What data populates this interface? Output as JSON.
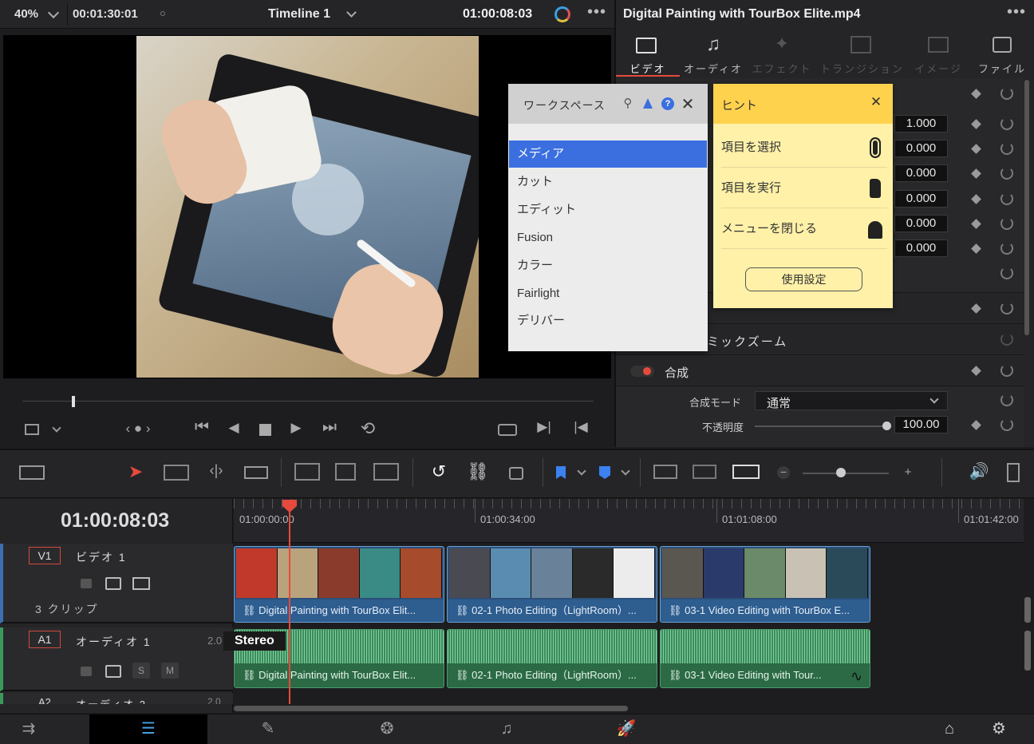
{
  "viewer": {
    "zoom": "40%",
    "duration": "00:01:30:01",
    "timeline_name": "Timeline 1",
    "timecode": "01:00:08:03"
  },
  "inspector": {
    "filename": "Digital Painting with TourBox Elite.mp4",
    "tabs": [
      {
        "label": "ビデオ",
        "icon": "film-icon"
      },
      {
        "label": "オーディオ",
        "icon": "music-note-icon"
      },
      {
        "label": "エフェクト",
        "icon": "magic-wand-icon"
      },
      {
        "label": "トランジション",
        "icon": "transition-icon"
      },
      {
        "label": "イメージ",
        "icon": "image-icon"
      },
      {
        "label": "ファイル",
        "icon": "file-icon"
      }
    ],
    "values": [
      "1.000",
      "0.000",
      "0.000",
      "0.000",
      "0.000",
      "0.000"
    ],
    "dynamic_zoom_label": "ミックズーム",
    "composite_label": "合成",
    "composite_mode_label": "合成モード",
    "composite_mode_value": "通常",
    "opacity_label": "不透明度",
    "opacity_value": "100.00"
  },
  "workspace_menu": {
    "title": "ワークスペース",
    "items": [
      "メディア",
      "カット",
      "エディット",
      "Fusion",
      "カラー",
      "Fairlight",
      "デリバー"
    ],
    "selected_index": 0
  },
  "hint_panel": {
    "title": "ヒント",
    "items": [
      "項目を選択",
      "項目を実行",
      "メニューを閉じる"
    ],
    "settings_button": "使用設定",
    "accent": "#ffd24d"
  },
  "timeline": {
    "timecode": "01:00:08:03",
    "ruler": [
      "01:00:00:00",
      "01:00:34:00",
      "01:01:08:00",
      "01:01:42:00"
    ],
    "video_track": {
      "id": "V1",
      "name": "ビデオ 1",
      "clips_count": "3 クリップ"
    },
    "audio_track": {
      "id": "A1",
      "name": "オーディオ 1",
      "channels": "2.0",
      "format": "Stereo",
      "solo": "S",
      "mute": "M"
    },
    "audio_track2": {
      "id": "A2",
      "name": "オーディオ 2",
      "channels": "2.0"
    },
    "video_clips": [
      "Digital Painting with TourBox Elit...",
      "02-1 Photo Editing（LightRoom）...",
      "03-1 Video Editing with TourBox E..."
    ],
    "audio_clips": [
      "Digital Painting with TourBox Elit...",
      "02-1 Photo Editing（LightRoom）...",
      "03-1 Video Editing with Tour..."
    ]
  },
  "colors": {
    "playhead": "#e64a3c",
    "video_clip": "#2e5d8f",
    "audio_clip": "#2e6e48",
    "selection": "#3b6fe0"
  }
}
